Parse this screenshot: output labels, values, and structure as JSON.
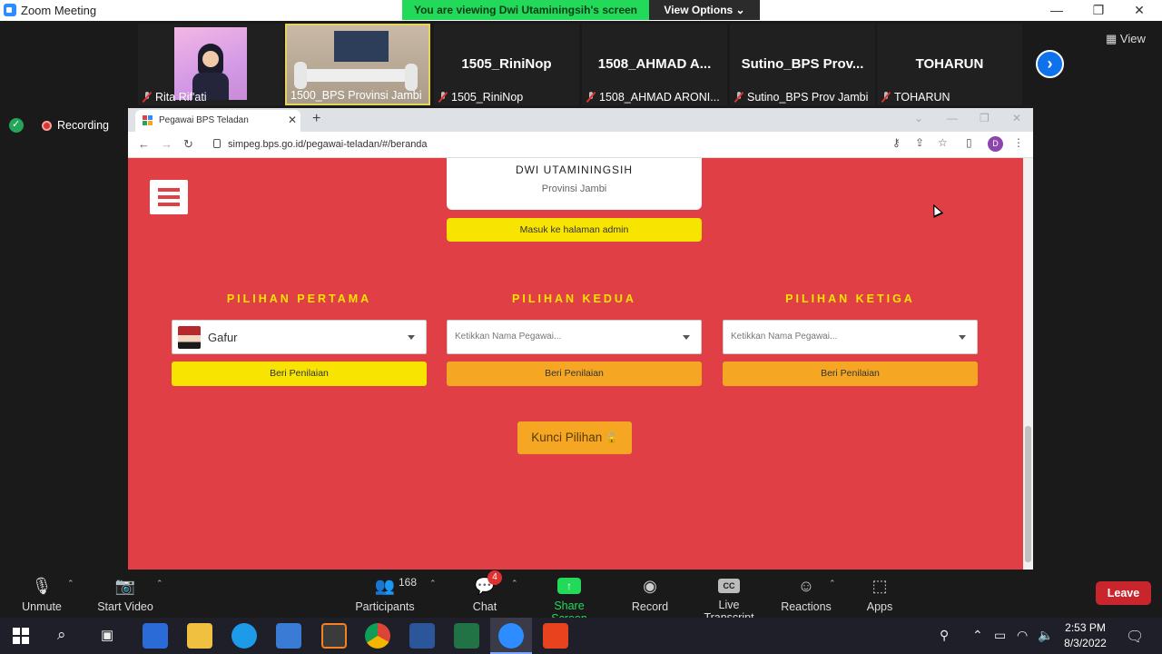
{
  "zoom": {
    "window_title": "Zoom Meeting",
    "banner": "You are viewing Dwi Utaminingsih's screen",
    "view_options": "View Options ⌄",
    "view_button": "View",
    "recording_label": "Recording",
    "participants": [
      {
        "label": "Rita Rif'ati",
        "big_name": ""
      },
      {
        "label": "1500_BPS Provinsi Jambi",
        "big_name": ""
      },
      {
        "label": "1505_RiniNop",
        "big_name": "1505_RiniNop"
      },
      {
        "label": "1508_AHMAD ARONI...",
        "big_name": "1508_AHMAD A..."
      },
      {
        "label": "Sutino_BPS Prov Jambi",
        "big_name": "Sutino_BPS  Prov..."
      },
      {
        "label": "TOHARUN",
        "big_name": "TOHARUN"
      }
    ],
    "toolbar": {
      "unmute": "Unmute",
      "start_video": "Start Video",
      "participants": "Participants",
      "participants_count": "168",
      "chat": "Chat",
      "chat_badge": "4",
      "share_screen": "Share Screen",
      "record": "Record",
      "live_transcript": "Live Transcript",
      "cc": "CC",
      "reactions": "Reactions",
      "apps": "Apps",
      "leave": "Leave"
    }
  },
  "browser": {
    "tab_title": "Pegawai BPS Teladan",
    "url": "simpeg.bps.go.id/pegawai-teladan/#/beranda",
    "profile_initial": "D"
  },
  "page": {
    "profile_name": "DWI UTAMININGSIH",
    "profile_region": "Provinsi Jambi",
    "admin_button": "Masuk ke halaman admin",
    "choices": [
      {
        "title": "PILIHAN PERTAMA",
        "selected": "Gafur",
        "placeholder": "",
        "button": "Beri Penilaian"
      },
      {
        "title": "PILIHAN KEDUA",
        "selected": "",
        "placeholder": "Ketikkan Nama Pegawai...",
        "button": "Beri Penilaian"
      },
      {
        "title": "PILIHAN KETIGA",
        "selected": "",
        "placeholder": "Ketikkan Nama Pegawai...",
        "button": "Beri Penilaian"
      }
    ],
    "lock_button": "Kunci Pilihan"
  },
  "taskbar": {
    "time": "2:53 PM",
    "date": "8/3/2022"
  },
  "colors": {
    "page_bg": "#e04045",
    "accent_yellow": "#f7e400",
    "accent_orange": "#f5a623",
    "zoom_green": "#23d959",
    "leave_red": "#c9252d"
  }
}
